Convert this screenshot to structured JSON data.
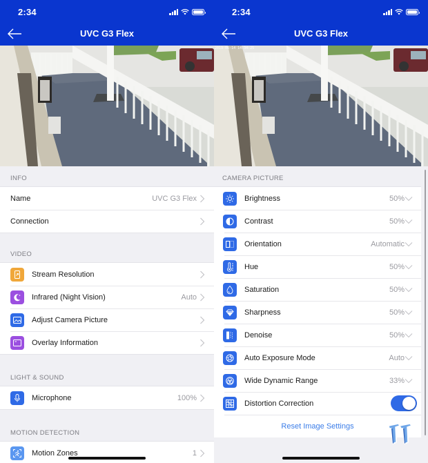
{
  "status_bar": {
    "time": "2:34"
  },
  "colors": {
    "nav_blue": "#0a36cf",
    "icon_blue": "#2f6ae6",
    "icon_orange": "#f0a73a",
    "icon_purple": "#9b4fe0",
    "icon_light_blue": "#5a97f0",
    "toggle_on": "#2f6ae6",
    "link_blue": "#3b7de8"
  },
  "left_screen": {
    "nav": {
      "title": "UVC G3 Flex",
      "back_icon": "arrow-left-icon"
    },
    "sections": [
      {
        "header": "INFO",
        "rows": [
          {
            "label": "Name",
            "value": "UVC G3 Flex"
          },
          {
            "label": "Connection",
            "value": ""
          }
        ]
      },
      {
        "header": "VIDEO",
        "rows": [
          {
            "icon": "stream-resolution-icon",
            "label": "Stream Resolution",
            "value": ""
          },
          {
            "icon": "moon-icon",
            "label": "Infrared (Night Vision)",
            "value": "Auto"
          },
          {
            "icon": "picture-icon",
            "label": "Adjust Camera Picture",
            "value": ""
          },
          {
            "icon": "overlay-icon",
            "label": "Overlay Information",
            "value": ""
          }
        ]
      },
      {
        "header": "LIGHT & SOUND",
        "rows": [
          {
            "icon": "microphone-icon",
            "label": "Microphone",
            "value": "100%"
          }
        ]
      },
      {
        "header": "MOTION DETECTION",
        "rows": [
          {
            "icon": "motion-zones-icon",
            "label": "Motion Zones",
            "value": "1"
          }
        ]
      }
    ]
  },
  "right_screen": {
    "nav": {
      "title": "UVC G3 Flex",
      "back_icon": "arrow-left-icon"
    },
    "camera_timestamp": "2019-06-14 14:34:25",
    "section_header": "CAMERA PICTURE",
    "rows": [
      {
        "icon": "brightness-icon",
        "label": "Brightness",
        "value": "50%"
      },
      {
        "icon": "contrast-icon",
        "label": "Contrast",
        "value": "50%"
      },
      {
        "icon": "orientation-icon",
        "label": "Orientation",
        "value": "Automatic"
      },
      {
        "icon": "hue-icon",
        "label": "Hue",
        "value": "50%"
      },
      {
        "icon": "saturation-icon",
        "label": "Saturation",
        "value": "50%"
      },
      {
        "icon": "sharpness-icon",
        "label": "Sharpness",
        "value": "50%"
      },
      {
        "icon": "denoise-icon",
        "label": "Denoise",
        "value": "50%"
      },
      {
        "icon": "auto-exposure-icon",
        "label": "Auto Exposure Mode",
        "value": "Auto"
      },
      {
        "icon": "wdr-icon",
        "label": "Wide Dynamic Range",
        "value": "33%"
      }
    ],
    "distortion": {
      "label": "Distortion Correction",
      "enabled": true
    },
    "reset_label": "Reset Image Settings"
  }
}
